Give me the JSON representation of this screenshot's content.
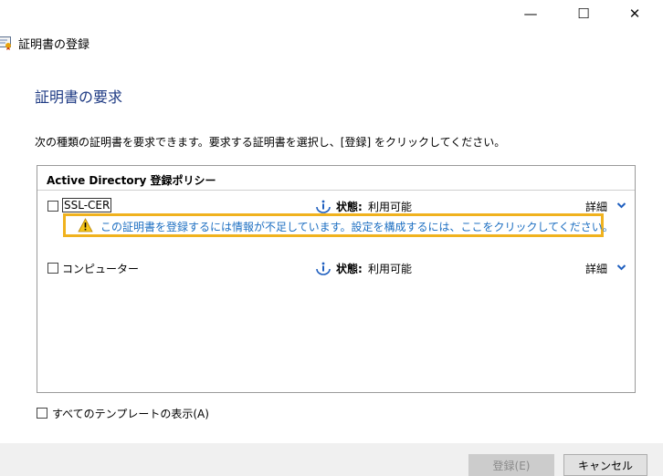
{
  "window": {
    "minimize_glyph": "—",
    "maximize_glyph": "☐",
    "close_glyph": "✕"
  },
  "header": {
    "title": "証明書の登録",
    "icon": "certificate-icon"
  },
  "page_title": "証明書の要求",
  "instructions": "次の種類の証明書を要求できます。要求する証明書を選択し、[登録] をクリックしてください。",
  "policy": {
    "title": "Active Directory 登録ポリシー",
    "certificates": [
      {
        "name": "SSL-CER",
        "checked": false,
        "status_label": "状態:",
        "status_value": "利用可能",
        "details_label": "詳細",
        "warning": "この証明書を登録するには情報が不足しています。設定を構成するには、ここをクリックしてください。"
      },
      {
        "name": "コンピューター",
        "checked": false,
        "status_label": "状態:",
        "status_value": "利用可能",
        "details_label": "詳細"
      }
    ]
  },
  "show_all": {
    "label": "すべてのテンプレートの表示(A)",
    "checked": false
  },
  "buttons": {
    "enroll": "登録(E)",
    "enroll_enabled": false,
    "cancel": "キャンセル"
  },
  "colors": {
    "title_blue": "#1f3b84",
    "link_blue": "#1d6fc2",
    "warning_highlight": "#f0b21e",
    "chevron_blue": "#1f5fbf",
    "footer_bg": "#f0f0f0"
  }
}
